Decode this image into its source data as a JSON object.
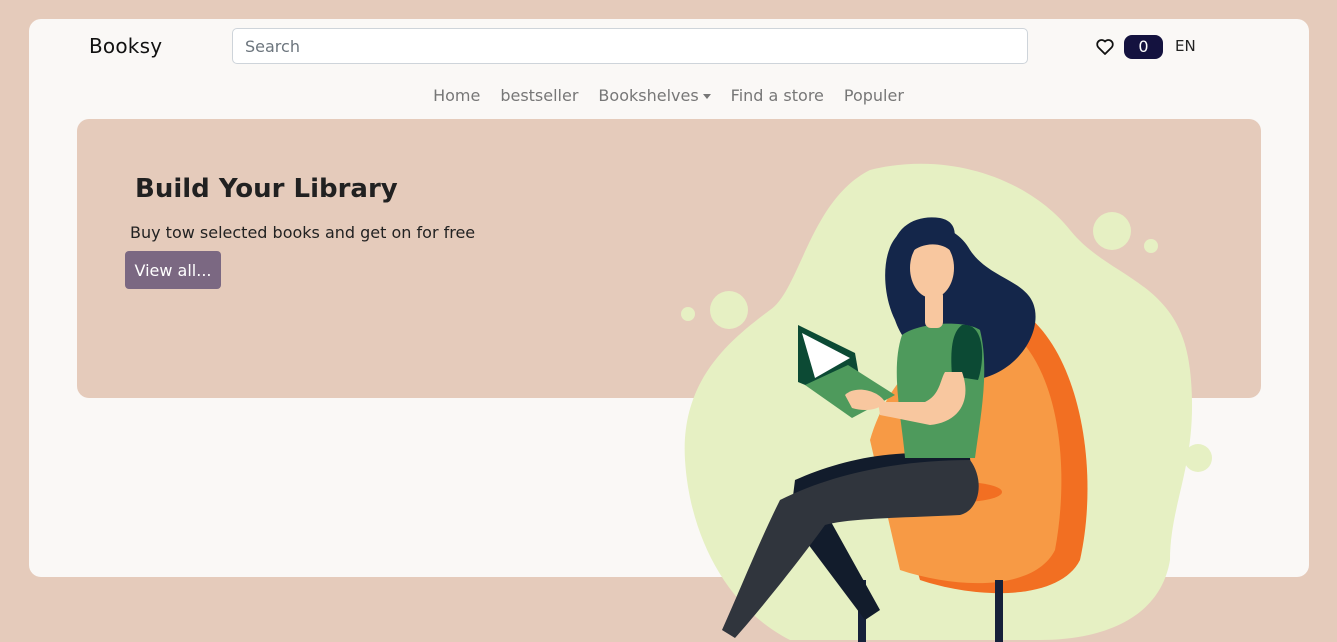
{
  "header": {
    "brand": "Booksy",
    "search_placeholder": "Search",
    "favorites_icon": "heart-icon",
    "cart_count": "0",
    "language": "EN"
  },
  "nav": {
    "items": [
      {
        "label": "Home"
      },
      {
        "label": "bestseller"
      },
      {
        "label": "Bookshelves",
        "dropdown": true
      },
      {
        "label": "Find a store"
      },
      {
        "label": "Populer"
      }
    ]
  },
  "hero": {
    "title": "Build Your Library",
    "subtitle": "Buy tow selected books and get on for free",
    "button_label": "View all..."
  },
  "colors": {
    "page_bg": "#e5cbbb",
    "card_bg": "#faf8f6",
    "badge_bg": "#14123f",
    "button_bg": "#7b6882",
    "blob": "#e6f0c3",
    "chair": "#f79a45",
    "shirt": "#4e9a5c",
    "hair": "#14264a"
  }
}
